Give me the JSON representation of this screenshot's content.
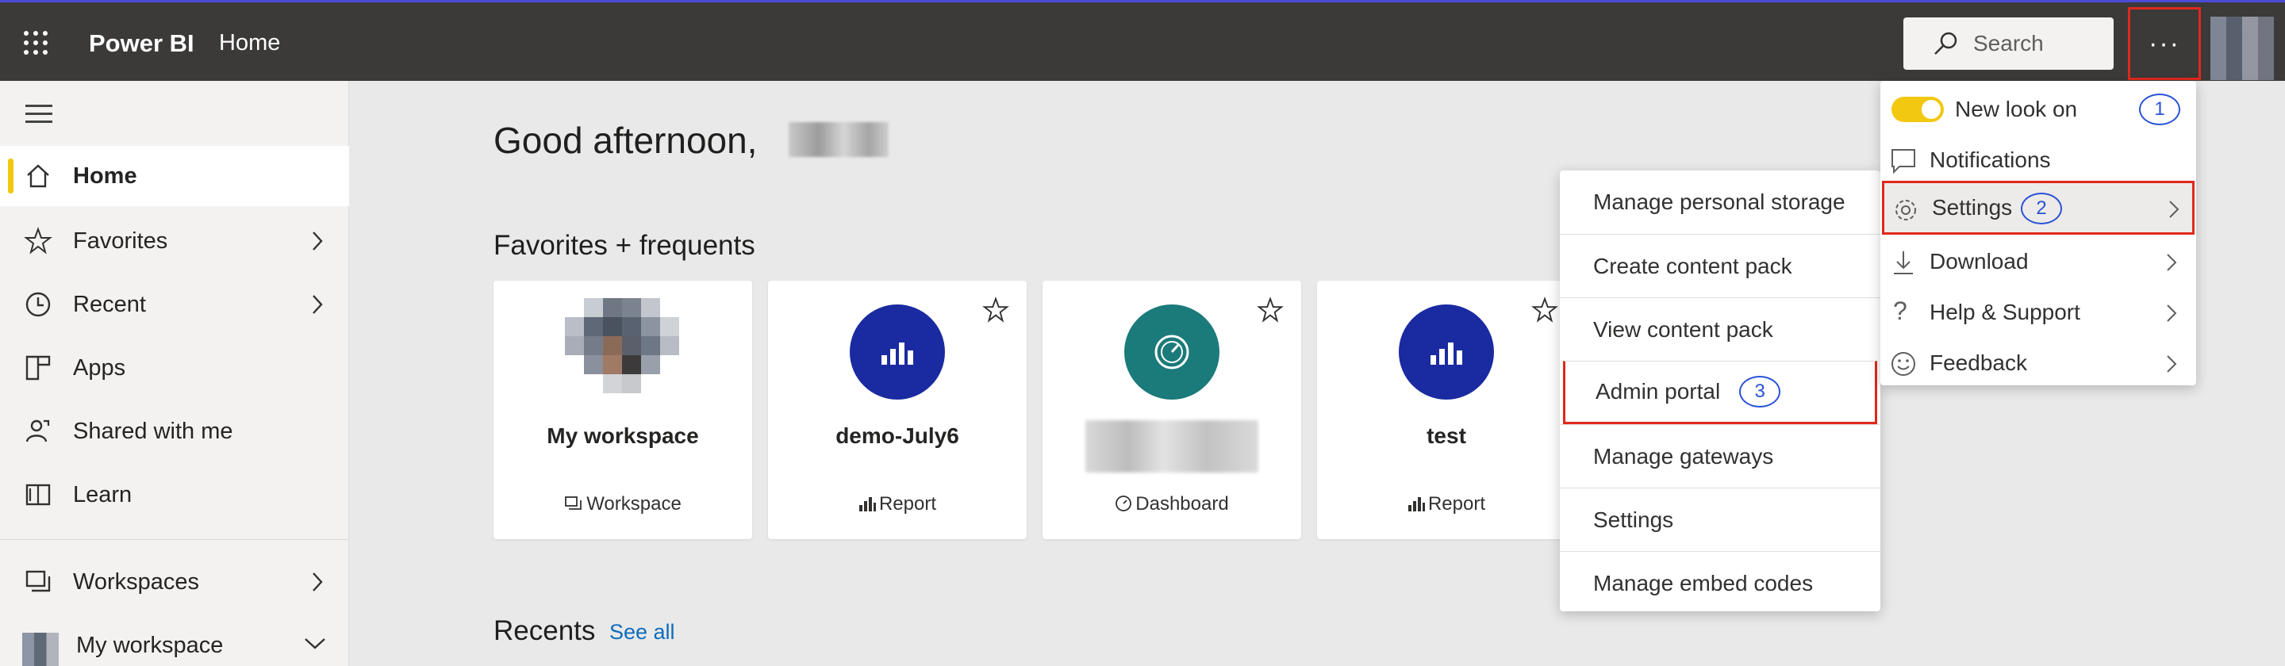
{
  "app": {
    "brand": "Power BI",
    "breadcrumb": "Home"
  },
  "search": {
    "placeholder": "Search"
  },
  "more_button": {
    "label": "···"
  },
  "sidebar": {
    "items": [
      {
        "label": "Home",
        "icon": "home-icon",
        "active": true
      },
      {
        "label": "Favorites",
        "icon": "star-icon",
        "chevron": true
      },
      {
        "label": "Recent",
        "icon": "clock-icon",
        "chevron": true
      },
      {
        "label": "Apps",
        "icon": "apps-icon"
      },
      {
        "label": "Shared with me",
        "icon": "shared-icon"
      },
      {
        "label": "Learn",
        "icon": "book-icon"
      },
      {
        "label": "Workspaces",
        "icon": "workspaces-icon",
        "chevron": true
      },
      {
        "label": "My workspace",
        "icon": "avatar",
        "chevron_down": true
      }
    ]
  },
  "main": {
    "greeting": "Good afternoon,",
    "favorites_title": "Favorites + frequents",
    "cards": [
      {
        "title": "My workspace",
        "type": "Workspace"
      },
      {
        "title": "demo-July6",
        "type": "Report"
      },
      {
        "title": "",
        "type": "Dashboard"
      },
      {
        "title": "test",
        "type": "Report"
      }
    ],
    "recents_title": "Recents",
    "see_all": "See all"
  },
  "settings_submenu": {
    "items": [
      "Manage personal storage",
      "Create content pack",
      "View content pack",
      "Admin portal",
      "Manage gateways",
      "Settings",
      "Manage embed codes"
    ],
    "highlight_badge": "3"
  },
  "more_menu": {
    "items": [
      {
        "label": "New look on",
        "badge": "1"
      },
      {
        "label": "Notifications"
      },
      {
        "label": "Settings",
        "badge": "2"
      },
      {
        "label": "Download"
      },
      {
        "label": "Help & Support"
      },
      {
        "label": "Feedback"
      }
    ]
  },
  "colors": {
    "topbar": "#3b3a39",
    "accent_yellow": "#f2c811",
    "report_blue": "#1a2aa0",
    "dashboard_teal": "#1b7a7a",
    "highlight_red": "#e0281d"
  }
}
